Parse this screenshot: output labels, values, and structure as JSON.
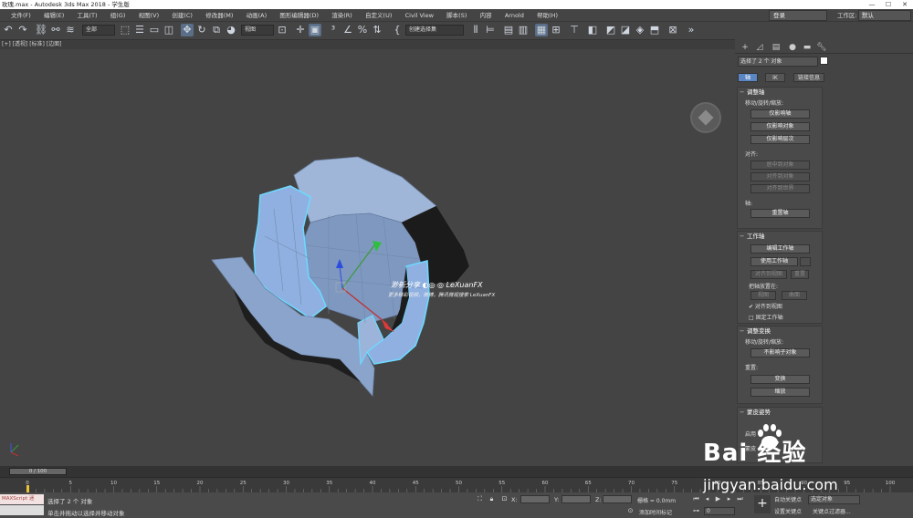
{
  "window": {
    "title": "玫瑰.max - Autodesk 3ds Max 2018  - 学生版",
    "min": "—",
    "max": "☐",
    "close": "✕"
  },
  "menu": [
    "文件(F)",
    "编辑(E)",
    "工具(T)",
    "组(G)",
    "视图(V)",
    "创建(C)",
    "修改器(M)",
    "动画(A)",
    "图形编辑器(D)",
    "渲染(R)",
    "自定义(U)",
    "Civil View",
    "脚本(S)",
    "内容",
    "Arnold",
    "帮助(H)"
  ],
  "login": "登录",
  "workspace": {
    "label": "工作区:",
    "value": "默认"
  },
  "toolbar": {
    "selection_filter": "全部",
    "coord_system": "视图",
    "named_selection": "创建选择集"
  },
  "viewport": {
    "label": "[+] [透视] [标准] [边面]"
  },
  "watermark": {
    "title": "渺新分享 ◐◎ ◎ LeXuanFX",
    "sub": "更多精彩视频，微博，腾讯微视搜索 LeXuanFX"
  },
  "panel": {
    "selection_info": "选择了 2 个 对象",
    "tabs": [
      "轴",
      "IK",
      "链接信息"
    ],
    "adjust_pivot": {
      "title": "调整轴",
      "move_label": "移动/旋转/缩放:",
      "buttons": [
        "仅影响轴",
        "仅影响对象",
        "仅影响层次"
      ],
      "align_label": "对齐:",
      "align_buttons": [
        "居中到对象",
        "对齐到对象",
        "对齐到世界"
      ],
      "pivot_label": "轴:",
      "reset_button": "重置轴"
    },
    "working_pivot": {
      "title": "工作轴",
      "edit": "编辑工作轴",
      "use": "使用工作轴",
      "align_view": "对齐到视图",
      "reset": "重置",
      "place_label": "把轴放置在:",
      "view": "视图",
      "surface": "曲面",
      "align_check": "✔ 对齐到视图",
      "fixed_check": "□ 固定工作轴"
    },
    "adjust_transform": {
      "title": "调整变换",
      "move_label": "移动/旋转/缩放:",
      "children_button": "不影响子对象",
      "reset_label": "重置:",
      "transform_button": "变换",
      "scale_button": "缩放"
    },
    "skin_pose": {
      "title": "蒙皮姿势",
      "line1": "启用",
      "line2": "蒙皮"
    }
  },
  "timeline": {
    "slider": "0 / 100",
    "ticks": [
      "0",
      "5",
      "10",
      "15",
      "20",
      "25",
      "30",
      "35",
      "40",
      "45",
      "50",
      "55",
      "60",
      "65",
      "70",
      "75",
      "80",
      "85",
      "90",
      "95",
      "100"
    ]
  },
  "status": {
    "maxscript": "MAXScript 迷",
    "selected": "选择了 2 个 对象",
    "hint": "单击并拖动以选择并移动对象",
    "x": "X:",
    "y": "Y:",
    "z": "Z:",
    "grid": "栅格 = 0.0mm",
    "add_time": "添加时间标记",
    "auto_key": "自动关键点",
    "selected_object": "选定对象",
    "set_key": "设置关键点",
    "key_filter": "关键点过滤器...",
    "frame": "0"
  },
  "baidu": {
    "logo": "Bai 经验",
    "url": "jingyan.baidu.com"
  }
}
